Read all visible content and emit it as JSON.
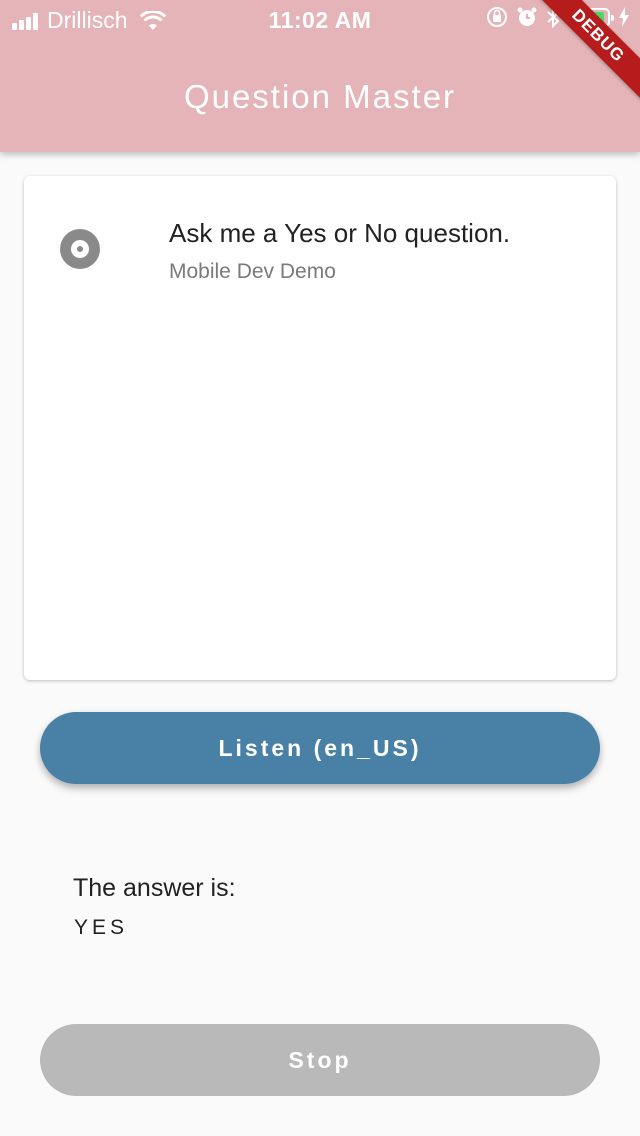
{
  "status_bar": {
    "carrier": "Drillisch",
    "time": "11:02 AM",
    "battery_level": 0.95,
    "colors": {
      "battery_fill": "#4cd964"
    },
    "icons": [
      "signal-icon",
      "wifi-icon",
      "orientation-lock-icon",
      "alarm-icon",
      "bluetooth-icon",
      "battery-icon",
      "charging-bolt-icon"
    ]
  },
  "app_bar": {
    "title": "Question Master",
    "debug_banner": "DEBUG",
    "colors": {
      "background": "#e4b4b8",
      "banner": "#b71c1c"
    }
  },
  "card": {
    "icon": "record-icon",
    "title": "Ask me a Yes or No question.",
    "subtitle": "Mobile Dev Demo"
  },
  "listen_button": {
    "label": "Listen (en_US)",
    "color": "#4880a6"
  },
  "answer": {
    "label": "The answer is:",
    "value": "YES"
  },
  "stop_button": {
    "label": "Stop",
    "color": "#b9b9b9"
  }
}
